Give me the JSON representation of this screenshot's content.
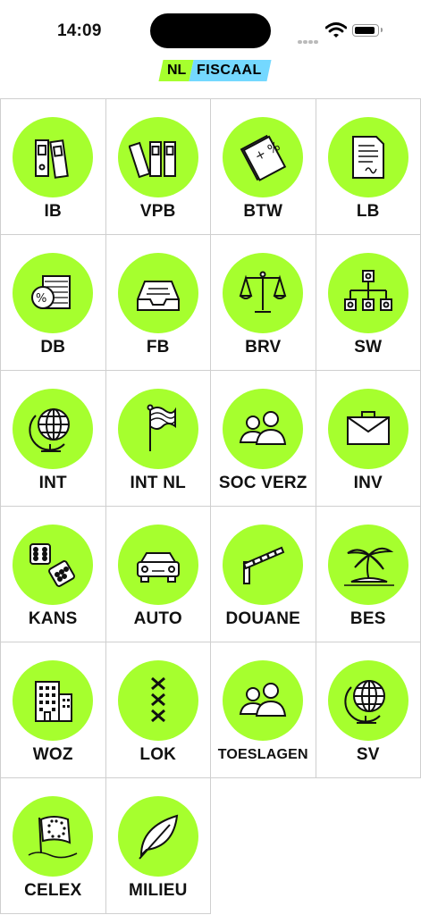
{
  "status_bar": {
    "time": "14:09"
  },
  "brand": {
    "nl": "NL",
    "fiscaal": "FISCAAL"
  },
  "tiles": [
    {
      "label": "IB",
      "icon": "binders-two-icon"
    },
    {
      "label": "VPB",
      "icon": "binders-three-icon"
    },
    {
      "label": "BTW",
      "icon": "percent-document-icon"
    },
    {
      "label": "LB",
      "icon": "signed-document-icon"
    },
    {
      "label": "DB",
      "icon": "percent-papers-icon"
    },
    {
      "label": "FB",
      "icon": "inbox-tray-icon"
    },
    {
      "label": "BRV",
      "icon": "scales-icon"
    },
    {
      "label": "SW",
      "icon": "org-chart-icon"
    },
    {
      "label": "INT",
      "icon": "globe-icon"
    },
    {
      "label": "INT NL",
      "icon": "flag-icon"
    },
    {
      "label": "SOC VERZ",
      "icon": "people-icon"
    },
    {
      "label": "INV",
      "icon": "briefcase-icon"
    },
    {
      "label": "KANS",
      "icon": "dice-icon"
    },
    {
      "label": "AUTO",
      "icon": "car-icon"
    },
    {
      "label": "DOUANE",
      "icon": "barrier-icon"
    },
    {
      "label": "BES",
      "icon": "palm-island-icon"
    },
    {
      "label": "WOZ",
      "icon": "buildings-icon"
    },
    {
      "label": "LOK",
      "icon": "amsterdam-crosses-icon"
    },
    {
      "label": "TOESLAGEN",
      "icon": "people-icon"
    },
    {
      "label": "SV",
      "icon": "globe-icon"
    },
    {
      "label": "CELEX",
      "icon": "eu-flag-icon"
    },
    {
      "label": "MILIEU",
      "icon": "leaf-icon"
    }
  ]
}
